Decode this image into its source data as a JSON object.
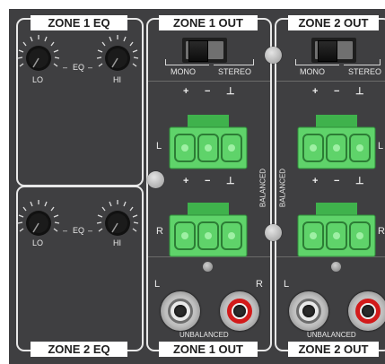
{
  "labels": {
    "zone1_eq": "ZONE 1 EQ",
    "zone2_eq": "ZONE 2 EQ",
    "zone1_out_top": "ZONE 1 OUT",
    "zone2_out_top": "ZONE 2 OUT",
    "zone1_out_bottom": "ZONE 1 OUT",
    "zone2_out_bottom": "ZONE 2 OUT"
  },
  "eq": {
    "lo": "LO",
    "hi": "HI",
    "eq": "EQ"
  },
  "switch": {
    "mono": "MONO",
    "stereo": "STEREO"
  },
  "pins": {
    "plus": "+",
    "minus": "−",
    "ground": "⊥"
  },
  "channels": {
    "left": "L",
    "right": "R"
  },
  "balanced": "BALANCED",
  "unbalanced": "UNBALANCED",
  "colors": {
    "panel": "#3f3f41",
    "terminal_green": "#5fd36a",
    "rca_red": "#d21a1a"
  }
}
